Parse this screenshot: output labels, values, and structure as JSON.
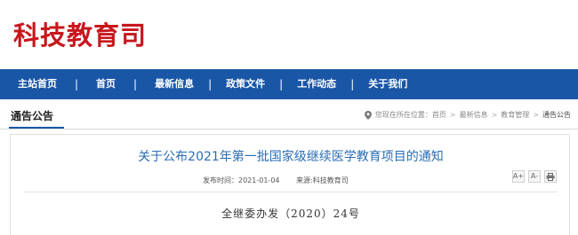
{
  "site": {
    "title": "科技教育司"
  },
  "nav": {
    "items": [
      "主站首页",
      "首页",
      "最新信息",
      "政策文件",
      "工作动态",
      "关于我们"
    ],
    "separator": "|"
  },
  "section": {
    "title": "通告公告"
  },
  "breadcrumb": {
    "prefix": "您现在所在位置：",
    "items": [
      "首页",
      "最新信息",
      "教育管理",
      "通告公告"
    ],
    "separator": ">"
  },
  "article": {
    "title": "关于公布2021年第一批国家级继续医学教育项目的通知",
    "publish_label": "发布时间：",
    "publish_date": "2021-01-04",
    "source_label": "来源:",
    "source": "科技教育司",
    "doc_number": "全继委办发（2020）24号"
  },
  "tools": {
    "font_increase": "A+",
    "font_decrease": "A-",
    "print_icon": "printer-icon",
    "location_icon": "location-pin-icon"
  },
  "colors": {
    "brand_red": "#c8161d",
    "nav_blue": "#1a56a6",
    "title_blue": "#2a6db5"
  }
}
